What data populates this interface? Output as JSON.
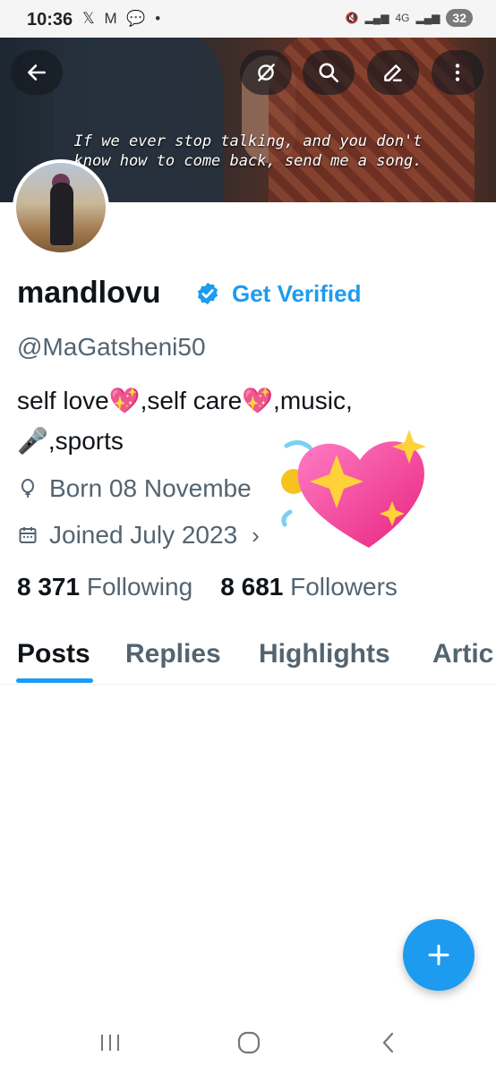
{
  "status_bar": {
    "time": "10:36",
    "left_icons": "𝕏 M",
    "network": "4G",
    "battery": "32"
  },
  "banner": {
    "caption_line1": "If we ever stop talking, and you don't",
    "caption_line2": "know how to come back, send me a song."
  },
  "header_buttons": [
    "back-icon",
    "grok-icon",
    "search-icon",
    "edit-icon",
    "more-icon"
  ],
  "profile": {
    "name": "mandlovu",
    "get_verified": "Get Verified",
    "handle": "@MaGatsheni50",
    "bio": "self love💖,self care💖,music, 🎤,sports",
    "born": "Born 08 Novembe",
    "joined": "Joined July 2023",
    "following_count": "8 371",
    "following_label": "Following",
    "followers_count": "8 681",
    "followers_label": "Followers"
  },
  "tabs": [
    {
      "label": "Posts",
      "active": true
    },
    {
      "label": "Replies",
      "active": false
    },
    {
      "label": "Highlights",
      "active": false
    },
    {
      "label": "Artic",
      "active": false
    }
  ],
  "colors": {
    "accent": "#1d9bf0",
    "text_primary": "#0f1419",
    "text_secondary": "#536471"
  }
}
